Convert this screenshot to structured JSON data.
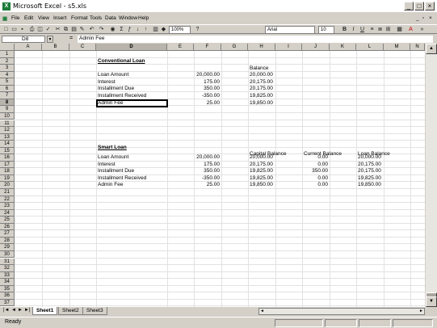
{
  "window": {
    "title": "Microsoft Excel - s5.xls",
    "icon": "excel-icon"
  },
  "menu": [
    "File",
    "Edit",
    "View",
    "Insert",
    "Format",
    "Tools",
    "Data",
    "Window",
    "Help"
  ],
  "toolbar": {
    "zoom": "100%",
    "font": "Arial",
    "size": "10"
  },
  "formula": {
    "name_box": "D8",
    "fx": "=",
    "value": "Admin Fee"
  },
  "columns": [
    "A",
    "B",
    "C",
    "D",
    "E",
    "F",
    "G",
    "H",
    "I",
    "J",
    "K",
    "L",
    "M",
    "N"
  ],
  "rows": [
    "1",
    "2",
    "3",
    "4",
    "5",
    "6",
    "7",
    "8",
    "9",
    "10",
    "11",
    "12",
    "13",
    "14",
    "15",
    "16",
    "17",
    "18",
    "19",
    "20",
    "21",
    "22",
    "23",
    "24",
    "25",
    "26",
    "27",
    "28",
    "29",
    "30",
    "31",
    "32",
    "33",
    "34",
    "35",
    "36",
    "37"
  ],
  "conventional": {
    "title": "Conventional Loan",
    "balance_header": "Balance",
    "rows": [
      {
        "label": "Loan Amount",
        "amount": "20,000.00",
        "balance": "20,000.00"
      },
      {
        "label": "Interest",
        "amount": "175.00",
        "balance": "20,175.00"
      },
      {
        "label": "Installment Due",
        "amount": "350.00",
        "balance": "20,175.00"
      },
      {
        "label": "Installment Received",
        "amount": "-350.00",
        "balance": "19,825.00"
      },
      {
        "label": "Admin Fee",
        "amount": "25.00",
        "balance": "19,850.00"
      }
    ]
  },
  "smart": {
    "title": "Smart Loan",
    "headers": [
      "Capital Balance",
      "Current Balance",
      "Loan Balance"
    ],
    "rows": [
      {
        "label": "Loan Amount",
        "amount": "20,000.00",
        "capital": "20,000.00",
        "current": "0.00",
        "loan": "20,000.00"
      },
      {
        "label": "Interest",
        "amount": "175.00",
        "capital": "20,175.00",
        "current": "0.00",
        "loan": "20,175.00"
      },
      {
        "label": "Installment Due",
        "amount": "350.00",
        "capital": "19,825.00",
        "current": "350.00",
        "loan": "20,175.00"
      },
      {
        "label": "Installment Received",
        "amount": "-350.00",
        "capital": "19,825.00",
        "current": "0.00",
        "loan": "19,825.00"
      },
      {
        "label": "Admin Fee",
        "amount": "25.00",
        "capital": "19,850.00",
        "current": "0.00",
        "loan": "19,850.00"
      }
    ]
  },
  "sheets": [
    "Sheet1",
    "Sheet2",
    "Sheet3"
  ],
  "status": "Ready"
}
